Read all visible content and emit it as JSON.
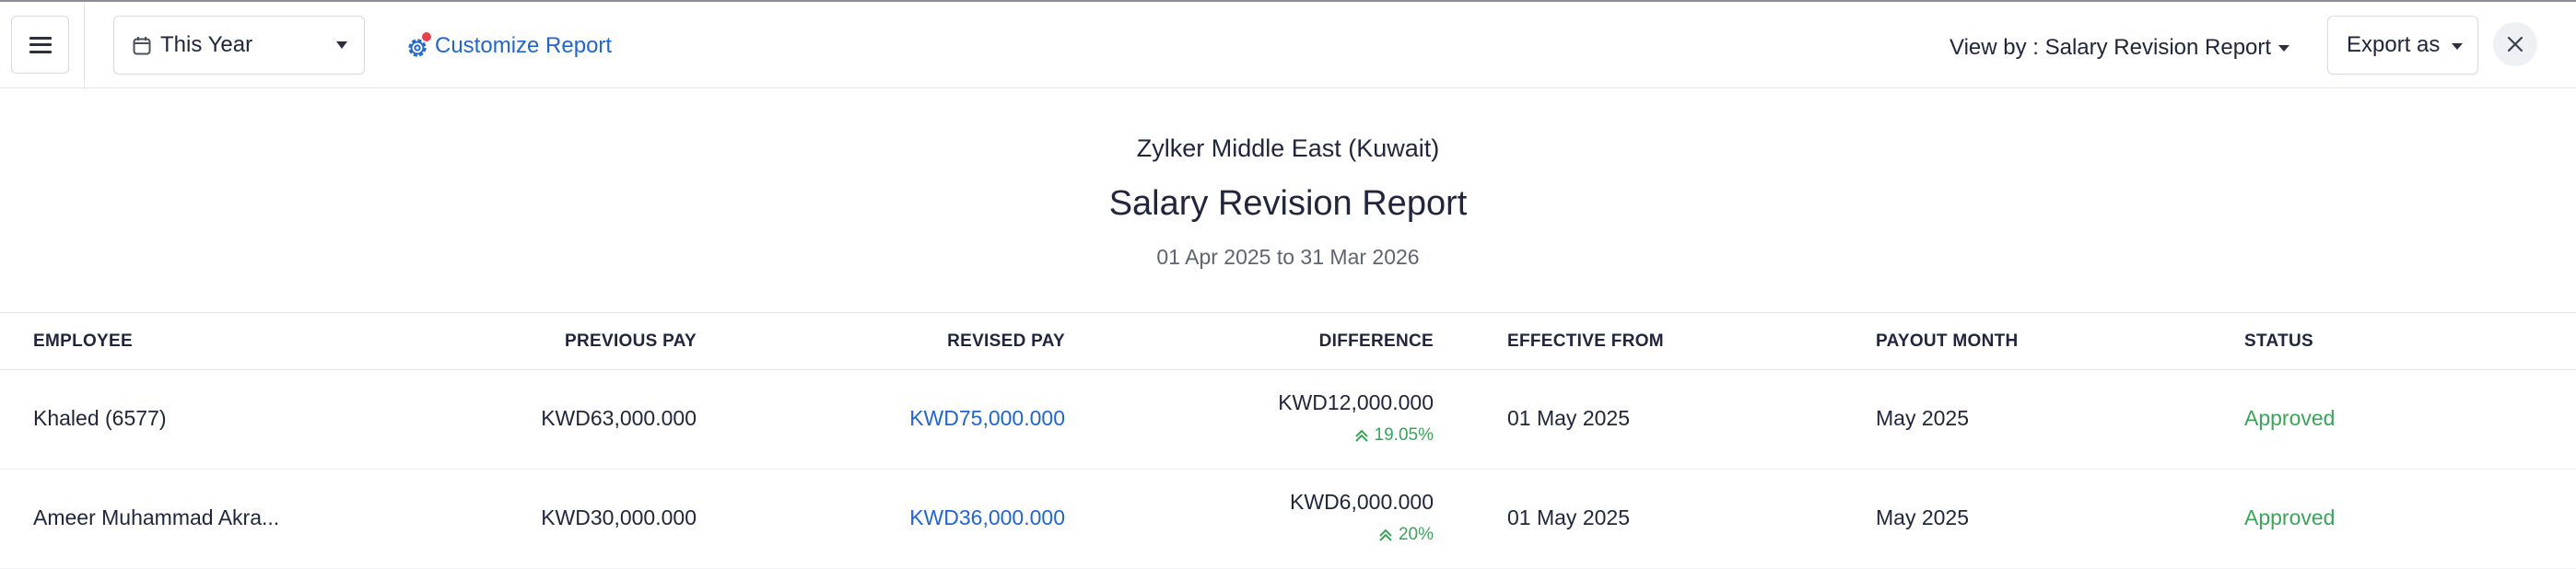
{
  "toolbar": {
    "menu_icon": "hamburger-icon",
    "period": {
      "icon": "calendar-icon",
      "value": "This Year"
    },
    "customize": {
      "icon": "gear-icon",
      "label": "Customize Report"
    },
    "view_by": {
      "label": "View by : Salary Revision Report"
    },
    "export": {
      "label": "Export as"
    },
    "close_icon": "close-icon"
  },
  "report": {
    "organization": "Zylker Middle East (Kuwait)",
    "title": "Salary Revision Report",
    "date_range": "01 Apr 2025 to 31 Mar 2026"
  },
  "table": {
    "columns": {
      "employee": "EMPLOYEE",
      "previous_pay": "PREVIOUS PAY",
      "revised_pay": "REVISED PAY",
      "difference": "DIFFERENCE",
      "effective_from": "EFFECTIVE FROM",
      "payout_month": "PAYOUT MONTH",
      "status": "STATUS"
    },
    "rows": [
      {
        "employee": "Khaled (6577)",
        "previous_pay": "KWD63,000.000",
        "revised_pay": "KWD75,000.000",
        "difference": "KWD12,000.000",
        "difference_pct": "19.05%",
        "effective_from": "01 May 2025",
        "payout_month": "May 2025",
        "status": "Approved"
      },
      {
        "employee": "Ameer Muhammad Akra...",
        "previous_pay": "KWD30,000.000",
        "revised_pay": "KWD36,000.000",
        "difference": "KWD6,000.000",
        "difference_pct": "20%",
        "effective_from": "01 May 2025",
        "payout_month": "May 2025",
        "status": "Approved"
      }
    ]
  },
  "colors": {
    "link": "#2166d0",
    "approved": "#3aa55a",
    "notification_dot": "#e8404b",
    "text": "#21263c",
    "muted": "#5f6470"
  }
}
